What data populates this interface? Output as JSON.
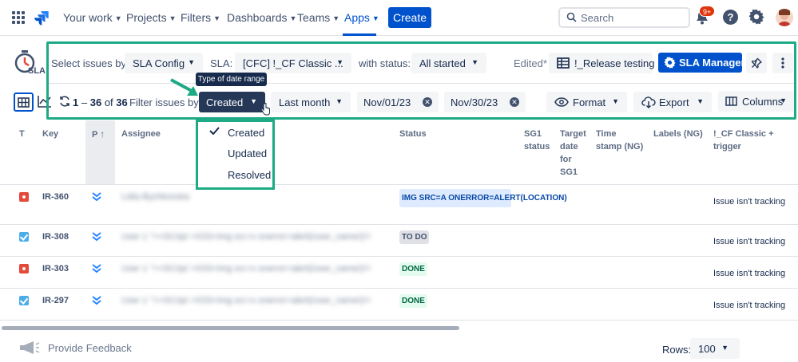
{
  "nav": {
    "items": [
      "Your work",
      "Projects",
      "Filters",
      "Dashboards",
      "Teams",
      "Apps"
    ],
    "active": "Apps",
    "create_label": "Create",
    "search_placeholder": "Search",
    "notification_badge": "9+",
    "help_label": "?"
  },
  "toolbar": {
    "logo_text": "SLA",
    "select_issues_by_label": "Select issues by:",
    "select_issues_by_value": "SLA Config",
    "sla_label": "SLA:",
    "sla_value": "[CFC] !_CF Classic ...",
    "with_status_label": "with status:",
    "with_status_value": "All started",
    "edited_label": "Edited*",
    "release_testing_label": "!_Release testing",
    "sla_manager_label": "SLA Manager"
  },
  "filter_bar": {
    "tooltip": "Type of date range",
    "range_start": "1",
    "range_end": "36",
    "total": "36",
    "count_sep": "–",
    "count_of": "of",
    "filter_by_label": "Filter issues by:",
    "date_type_value": "Created",
    "period_value": "Last month",
    "date_from": "Nov/01/23",
    "date_to": "Nov/30/23",
    "format_label": "Format",
    "export_label": "Export",
    "columns_label": "Columns"
  },
  "date_type_menu": {
    "options": [
      "Created",
      "Updated",
      "Resolved"
    ],
    "selected": "Created"
  },
  "table": {
    "headers": {
      "t": "T",
      "key": "Key",
      "p": "P",
      "assignee": "Assignee",
      "status": "Status",
      "sg1_status": "SG1 status",
      "target_date": "Target date for SG1",
      "time_stamp": "Time stamp (NG)",
      "labels": "Labels (NG)",
      "cf_classic": "!_CF Classic + trigger"
    },
    "rows": [
      {
        "type": "bug",
        "key": "IR-360",
        "assignee": "Lidia Bychkovska",
        "status": "IMG SRC=A ONERROR=ALERT(LOCATION)",
        "status_kind": "xss",
        "cf": "Issue isn't tracking"
      },
      {
        "type": "task",
        "key": "IR-308",
        "assignee": "User 1 \"><SCript >XSS<img src=x onerror=alert(/user_name/)/>",
        "status": "TO DO",
        "status_kind": "todo",
        "cf": "Issue isn't tracking"
      },
      {
        "type": "bug",
        "key": "IR-303",
        "assignee": "User 1 \"><SCript >XSS<img src=x onerror=alert(/user_name/)/>",
        "status": "DONE",
        "status_kind": "done",
        "cf": "Issue isn't tracking"
      },
      {
        "type": "task",
        "key": "IR-297",
        "assignee": "User 1 \"><SCript >XSS<img src=x onerror=alert(/user_name/)/>",
        "status": "DONE",
        "status_kind": "done",
        "cf": "Issue isn't tracking"
      }
    ]
  },
  "footer": {
    "feedback_label": "Provide Feedback",
    "rows_label": "Rows:",
    "rows_value": "100"
  },
  "colors": {
    "brand": "#0052cc",
    "highlight": "#1eaa84",
    "dark_button": "#253858"
  }
}
